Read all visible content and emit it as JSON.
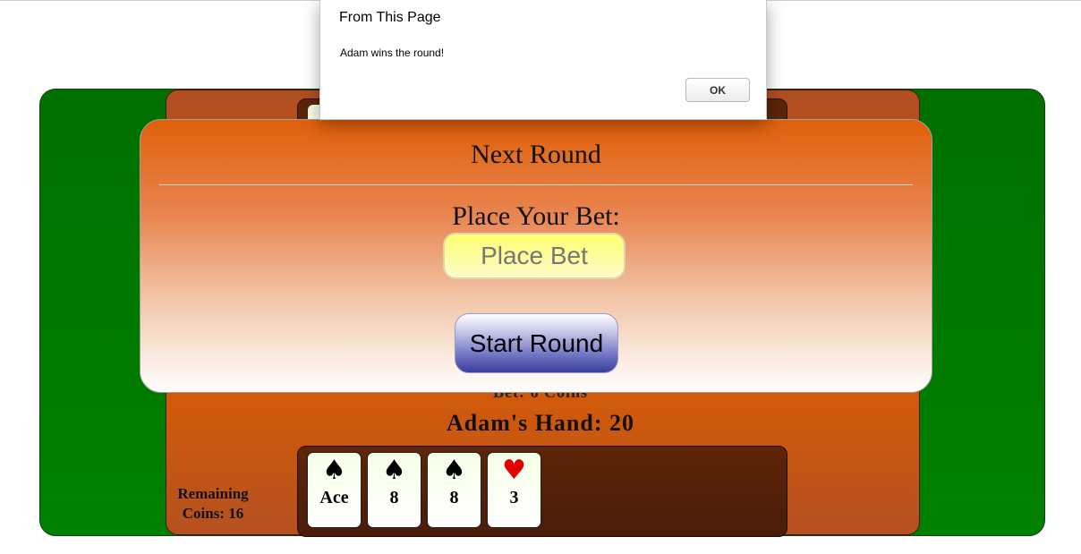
{
  "alert": {
    "title": "From This Page",
    "message": "Adam wins the round!",
    "ok_label": "OK"
  },
  "modal": {
    "title": "Next Round",
    "bet_label": "Place Your Bet:",
    "bet_placeholder": "Place Bet",
    "bet_value": "",
    "start_label": "Start Round"
  },
  "game": {
    "bet_text": "Bet: 6 Coins",
    "hand_title": "Adam's Hand: 20",
    "coins_line1": "Remaining",
    "coins_line2": "Coins: 16",
    "player_cards": [
      {
        "suit": "♠",
        "suit_name": "spade-icon",
        "rank": "Ace",
        "color": "#000000"
      },
      {
        "suit": "♠",
        "suit_name": "spade-icon",
        "rank": "8",
        "color": "#000000"
      },
      {
        "suit": "♠",
        "suit_name": "spade-icon",
        "rank": "8",
        "color": "#000000"
      },
      {
        "suit": "♥",
        "suit_name": "heart-icon",
        "rank": "3",
        "color": "#e00000"
      }
    ]
  },
  "colors": {
    "felt": "#007000",
    "board": "#d15a0a",
    "tray": "#5a2508",
    "bet_input": "#ffff70",
    "start_button": "#3b3e9c"
  }
}
